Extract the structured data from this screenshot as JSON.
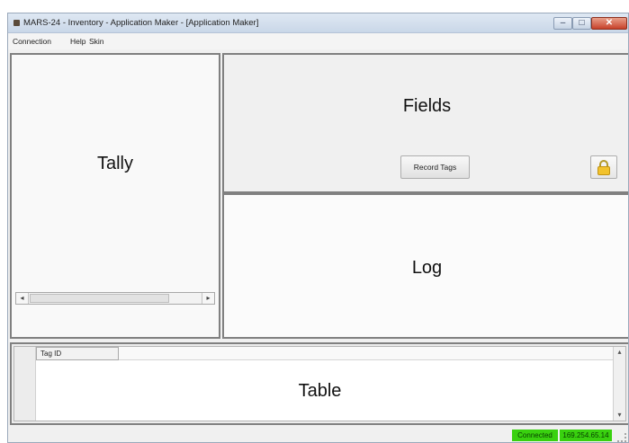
{
  "window": {
    "title": "MARS-24 - Inventory - Application Maker - [Application Maker]",
    "controls": {
      "minimize": "–",
      "maximize": "□",
      "close": "✕"
    }
  },
  "menu": {
    "items": [
      {
        "label": "Connection"
      },
      {
        "label": "Help"
      },
      {
        "label": "Skin"
      }
    ]
  },
  "panels": {
    "tally": {
      "label": "Tally"
    },
    "fields": {
      "label": "Fields",
      "record_button": "Record Tags"
    },
    "log": {
      "label": "Log"
    },
    "table": {
      "label": "Table",
      "columns": [
        "Tag ID"
      ]
    }
  },
  "scroll": {
    "left_arrow": "◂",
    "right_arrow": "▸",
    "up_arrow": "▴",
    "down_arrow": "▾"
  },
  "status": {
    "connection": "Connected",
    "ip": "169.254.65.14",
    "indicator_color": "#39d10f"
  },
  "icons": {
    "app": "app-icon",
    "lock": "lock-icon"
  }
}
